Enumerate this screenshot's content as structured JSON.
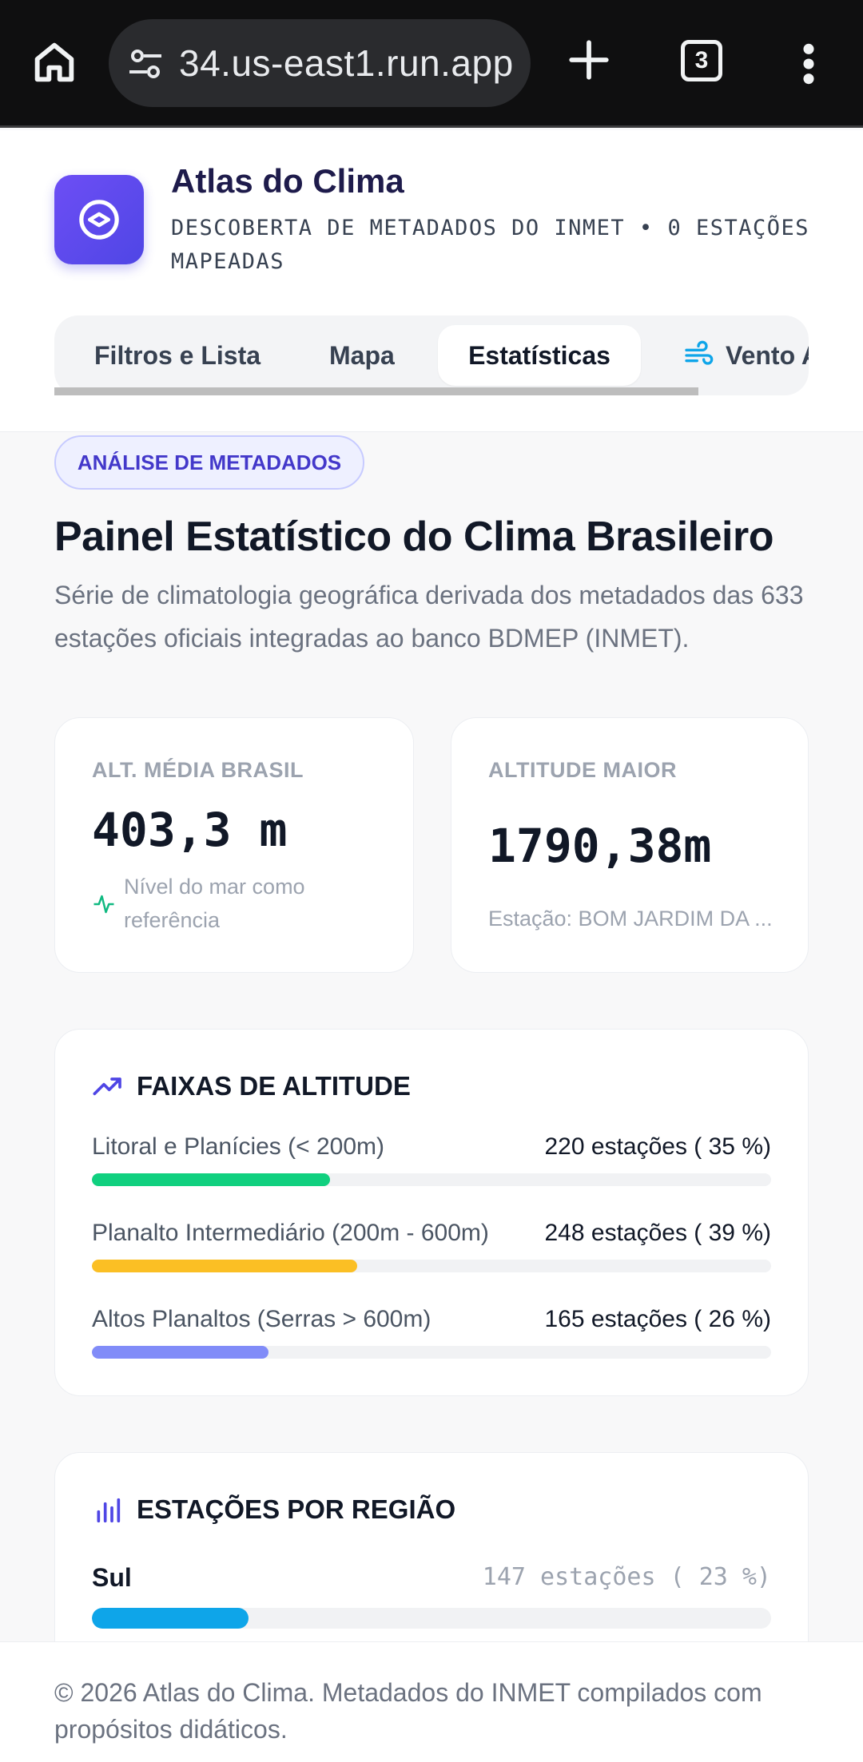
{
  "browser": {
    "url": "34.us-east1.run.app",
    "tab_count": "3"
  },
  "header": {
    "title": "Atlas do Clima",
    "subtitle": "DESCOBERTA DE METADADOS DO INMET • 0 ESTAÇÕES MAPEADAS"
  },
  "tabs": [
    {
      "label": "Filtros e Lista"
    },
    {
      "label": "Mapa"
    },
    {
      "label": "Estatísticas"
    },
    {
      "label": "Vento A"
    }
  ],
  "main": {
    "badge": "ANÁLISE DE METADADOS",
    "title": "Painel Estatístico do Clima Brasileiro",
    "description": "Série de climatologia geográfica derivada dos metadados das 633 estações oficiais integradas ao banco BDMEP (INMET)."
  },
  "stats": {
    "avg": {
      "label": "ALT. MÉDIA BRASIL",
      "value": "403,3 m",
      "note": "Nível do mar como referência"
    },
    "max": {
      "label": "ALTITUDE MAIOR",
      "value": "1790,38m",
      "note": "Estação: BOM JARDIM DA ..."
    }
  },
  "altitude": {
    "title": "FAIXAS DE ALTITUDE",
    "rows": [
      {
        "label": "Litoral e Planícies (< 200m)",
        "count": "220 estações ( 35 %)",
        "percent": 35,
        "color": "#10d07f"
      },
      {
        "label": "Planalto Intermediário (200m - 600m)",
        "count": "248 estações ( 39 %)",
        "percent": 39,
        "color": "#fbbf24"
      },
      {
        "label": "Altos Planaltos (Serras > 600m)",
        "count": "165 estações ( 26 %)",
        "percent": 26,
        "color": "#818cf8"
      }
    ]
  },
  "regions": {
    "title": "ESTAÇÕES POR REGIÃO",
    "rows": [
      {
        "label": "Sul",
        "count": "147 estações ( 23 %)",
        "percent": 23,
        "color": "#0ea5e9"
      }
    ]
  },
  "footer": {
    "text": "© 2026 Atlas do Clima. Metadados do INMET compilados com propósitos didáticos."
  },
  "colors": {
    "accent": "#4f46e5",
    "trend_icon": "#4f46e5",
    "pulse_icon": "#10b981",
    "wind_icon": "#0ea5e9"
  }
}
